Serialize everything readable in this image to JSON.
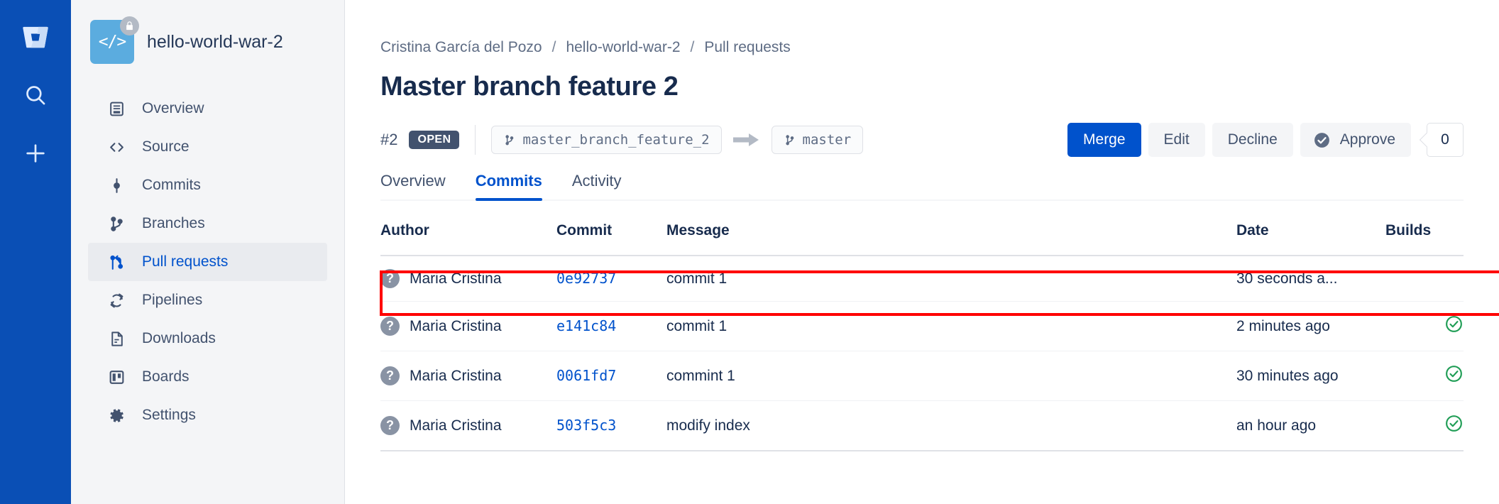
{
  "global_nav": {
    "items": [
      {
        "name": "bitbucket-logo",
        "label": "Bitbucket"
      },
      {
        "name": "search",
        "label": "Search"
      },
      {
        "name": "create",
        "label": "Create"
      }
    ]
  },
  "sidebar": {
    "repo_name": "hello-world-war-2",
    "repo_avatar_glyph": "</>",
    "repo_private_icon": "lock-icon",
    "items": [
      {
        "label": "Overview",
        "icon": "overview-icon",
        "active": false
      },
      {
        "label": "Source",
        "icon": "code-icon",
        "active": false
      },
      {
        "label": "Commits",
        "icon": "commit-icon",
        "active": false
      },
      {
        "label": "Branches",
        "icon": "branch-icon",
        "active": false
      },
      {
        "label": "Pull requests",
        "icon": "pull-request-icon",
        "active": true
      },
      {
        "label": "Pipelines",
        "icon": "pipelines-icon",
        "active": false
      },
      {
        "label": "Downloads",
        "icon": "downloads-icon",
        "active": false
      },
      {
        "label": "Boards",
        "icon": "boards-icon",
        "active": false
      },
      {
        "label": "Settings",
        "icon": "gear-icon",
        "active": false
      }
    ]
  },
  "breadcrumb": {
    "workspace": "Cristina García del Pozo",
    "repo": "hello-world-war-2",
    "section": "Pull requests",
    "separator": "/"
  },
  "pull_request": {
    "title": "Master branch feature 2",
    "id": "#2",
    "state": "OPEN",
    "source_branch": "master_branch_feature_2",
    "target_branch": "master",
    "arrow_icon": "arrow-right-icon"
  },
  "actions": {
    "merge_label": "Merge",
    "edit_label": "Edit",
    "decline_label": "Decline",
    "approve_label": "Approve",
    "approve_icon": "check-circle-icon",
    "approve_count": "0"
  },
  "tabs": [
    {
      "label": "Overview",
      "active": false
    },
    {
      "label": "Commits",
      "active": true
    },
    {
      "label": "Activity",
      "active": false
    }
  ],
  "commits_table": {
    "columns": [
      "Author",
      "Commit",
      "Message",
      "Date",
      "Builds"
    ],
    "rows": [
      {
        "author": "Maria Cristina",
        "avatar": "?",
        "hash": "0e92737",
        "message": "commit 1",
        "date": "30 seconds a...",
        "build": "",
        "highlighted": true
      },
      {
        "author": "Maria Cristina",
        "avatar": "?",
        "hash": "e141c84",
        "message": "commit 1",
        "date": "2 minutes ago",
        "build": "success",
        "highlighted": false
      },
      {
        "author": "Maria Cristina",
        "avatar": "?",
        "hash": "0061fd7",
        "message": "commint 1",
        "date": "30 minutes ago",
        "build": "success",
        "highlighted": false
      },
      {
        "author": "Maria Cristina",
        "avatar": "?",
        "hash": "503f5c3",
        "message": "modify index",
        "date": "an hour ago",
        "build": "success",
        "highlighted": false
      }
    ]
  },
  "colors": {
    "rail_blue": "#0a4fb5",
    "accent_blue": "#0052cc",
    "sidebar_bg": "#f4f5f7",
    "text_dark": "#172b4d",
    "text_muted": "#5e6c84",
    "lozenge_open": "#42526e",
    "build_success_green": "#00875a",
    "highlight_red": "#ff0000",
    "repo_avatar": "#5bacdf"
  }
}
